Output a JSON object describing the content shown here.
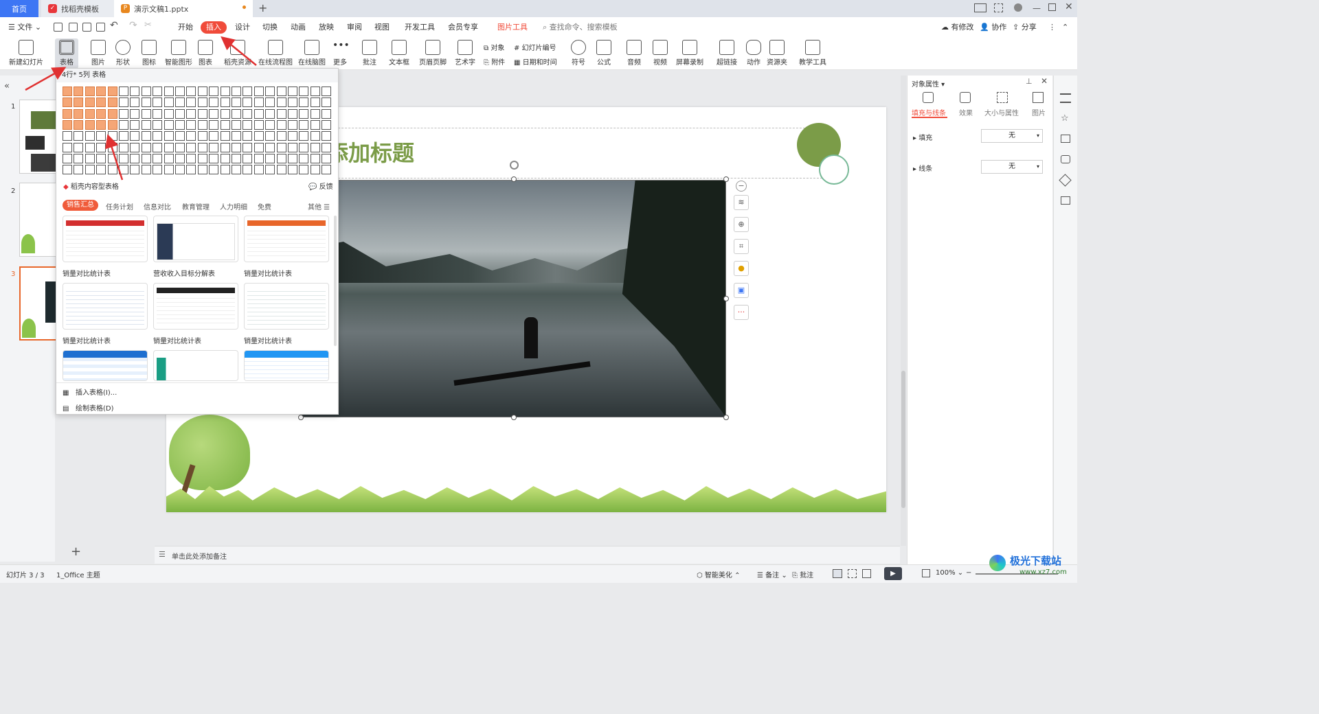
{
  "tabs": {
    "home": "首页",
    "template": "找稻壳模板",
    "document": "演示文稿1.pptx",
    "add": "+"
  },
  "menu": {
    "file": "文件",
    "items": [
      "开始",
      "插入",
      "设计",
      "切换",
      "动画",
      "放映",
      "审阅",
      "视图",
      "开发工具",
      "会员专享"
    ],
    "picture_tools": "图片工具",
    "search_placeholder": "查找命令、搜索模板",
    "modified": "有修改",
    "collab": "协作",
    "share": "分享"
  },
  "ribbon": {
    "new_slide": "新建幻灯片",
    "table": "表格",
    "picture": "图片",
    "shape": "形状",
    "icon": "图标",
    "smart": "智能图形",
    "chart": "图表",
    "resource": "稻壳资源",
    "flow": "在线流程图",
    "mind": "在线脑图",
    "more": "更多",
    "comment": "批注",
    "textbox": "文本框",
    "header": "页眉页脚",
    "wordart": "艺术字",
    "object": "对象",
    "attach": "附件",
    "slide_num": "幻灯片编号",
    "datetime": "日期和时间",
    "symbol": "符号",
    "formula": "公式",
    "audio": "音频",
    "video": "视频",
    "screenrec": "屏幕录制",
    "hyperlink": "超链接",
    "action": "动作",
    "resfolder": "资源夹",
    "teach": "教学工具"
  },
  "popup": {
    "header": "4行* 5列 表格",
    "rows_selected": 4,
    "cols_selected": 5,
    "grid_rows": 8,
    "grid_cols": 24,
    "brand_label": "稻壳内容型表格",
    "feedback": "反馈",
    "categories": [
      "销售汇总",
      "任务计划",
      "信息对比",
      "教育管理",
      "人力明细",
      "免费"
    ],
    "other": "其他",
    "templates": [
      "销量对比统计表",
      "营收收入目标分解表",
      "销量对比统计表",
      "销量对比统计表",
      "销量对比统计表",
      "销量对比统计表"
    ],
    "insert_table": "插入表格(I)...",
    "draw_table": "绘制表格(D)"
  },
  "slides": {
    "numbers": [
      "1",
      "2",
      "3"
    ],
    "title_text": "添加标题",
    "notes_placeholder": "单击此处添加备注",
    "add": "+"
  },
  "rpanel": {
    "title": "对象属性",
    "tabs": [
      "填充与线条",
      "效果",
      "大小与属性",
      "图片"
    ],
    "fill_label": "填充",
    "fill_value": "无",
    "line_label": "线条",
    "line_value": "无"
  },
  "status": {
    "slide_info": "幻灯片 3 / 3",
    "theme": "1_Office 主题",
    "beautify": "智能美化",
    "notes": "备注",
    "comment": "批注",
    "zoom": "100%"
  },
  "watermark": {
    "text": "极光下载站",
    "url": "www.xz7.com"
  },
  "colors": {
    "accent": "#f04b3a",
    "brand_blue": "#3d76f4",
    "cell_on": "#f5a676",
    "title_green": "#7b9c48"
  }
}
